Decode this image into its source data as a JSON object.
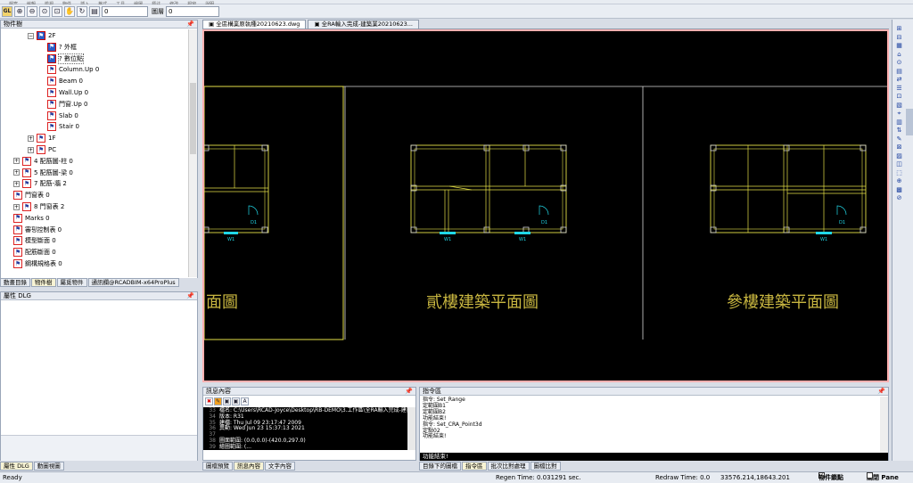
{
  "menu": [
    "檔案",
    "編輯",
    "檢視",
    "物件",
    "插入",
    "格式",
    "工具",
    "繪圖",
    "標註",
    "修改",
    "視窗",
    "說明"
  ],
  "toolbar": {
    "combo_value": "0",
    "layer_label": "圖層",
    "layer_value": "0",
    "gl_label": "GL"
  },
  "left_panel": {
    "title": "物件樹",
    "items": [
      {
        "label": "2F",
        "indent": 30,
        "exp": "−",
        "sel": true
      },
      {
        "label": "? 外框",
        "indent": 52,
        "sel": true
      },
      {
        "label": "? 數位點",
        "indent": 52,
        "sel": true,
        "hl": true
      },
      {
        "label": "Column.Up 0",
        "indent": 52
      },
      {
        "label": "Beam 0",
        "indent": 52
      },
      {
        "label": "Wall.Up 0",
        "indent": 52
      },
      {
        "label": "門窗.Up 0",
        "indent": 52
      },
      {
        "label": "Slab 0",
        "indent": 52
      },
      {
        "label": "Stair 0",
        "indent": 52
      },
      {
        "label": "1F",
        "indent": 30,
        "exp": "+"
      },
      {
        "label": "PC",
        "indent": 30,
        "exp": "+"
      },
      {
        "label": "4 配筋圖-柱 0",
        "indent": 14,
        "exp": "+"
      },
      {
        "label": "5 配筋圖-梁 0",
        "indent": 14,
        "exp": "+"
      },
      {
        "label": "7 配筋-牆 2",
        "indent": 14,
        "exp": "+"
      },
      {
        "label": "門窗表 0",
        "indent": 14
      },
      {
        "label": "8 門窗表 2",
        "indent": 14,
        "exp": "+"
      },
      {
        "label": "Marks 0",
        "indent": 14
      },
      {
        "label": "審핑控制表 0",
        "indent": 14
      },
      {
        "label": "模型斷面 0",
        "indent": 14
      },
      {
        "label": "配筋斷面 0",
        "indent": 14
      },
      {
        "label": "鋼構規格表 0",
        "indent": 14
      }
    ],
    "tabs": [
      "動畫目錄",
      "物件樹",
      "屬覓物件",
      "通訊欄@RCADBIM-x64ProPlus"
    ]
  },
  "prop_panel": {
    "title": "屬性 DLG",
    "tabs": [
      "屬性 DLG",
      "動圖視圖"
    ]
  },
  "doc_tabs": [
    "全區構業原執種20210623.dwg",
    "全RA輸入完成-建築業20210623..."
  ],
  "drawing": {
    "titles": [
      "面圖",
      "貳樓建築平面圖",
      "參樓建築平面圖"
    ],
    "door_label": "D1",
    "window_label": "W1",
    "colors": {
      "bg": "#000000",
      "frame_outer": "#ffb0b0",
      "wall": "#e5e048",
      "line": "#d8d8d8",
      "opening": "#20d8e8",
      "title": "#c8b640"
    }
  },
  "msg_panel": {
    "title": "訊息內容",
    "lines": [
      {
        "n": "33",
        "t": "檔名: C:\\Users\\RCAD-Joyce\\Desktop\\RB-DEMO\\3.工作區\\全RA輸入完成-建築"
      },
      {
        "n": "34",
        "t": "版本: R31"
      },
      {
        "n": "35",
        "t": "建檔: Thu Jul 09 23:17:47 2009"
      },
      {
        "n": "36",
        "t": "異動: Wed Jun 23 15:37:13 2021"
      },
      {
        "n": "37",
        "t": ""
      },
      {
        "n": "38",
        "t": "圖面範圍: (0.0,0.0)-(420.0,297.0)"
      },
      {
        "n": "39",
        "t": "繪圖範圍: (..."
      }
    ],
    "tabs": [
      "圖檔預覽",
      "訊息內容",
      "文字內容"
    ]
  },
  "cmd_panel": {
    "title": "指令區",
    "lines": [
      "指令: Set_Range",
      "定範圍B1",
      "定範圍B2",
      "功能結束!",
      "指令: Set_CRA_Point3d",
      "定點02",
      "功能結束!"
    ],
    "input": "功能結束!",
    "tabs": [
      "目錄下的圖檔",
      "指令區",
      "批次比對處理",
      "圖檔比對"
    ]
  },
  "status": {
    "ready": "Ready",
    "regen": "Regen Time: 0.031291 sec.",
    "redraw": "Redraw Time: 0.0",
    "coords": "33576.214,18643.201",
    "snap_label": "物件鎖點",
    "close_label": "關閉 Pane"
  }
}
